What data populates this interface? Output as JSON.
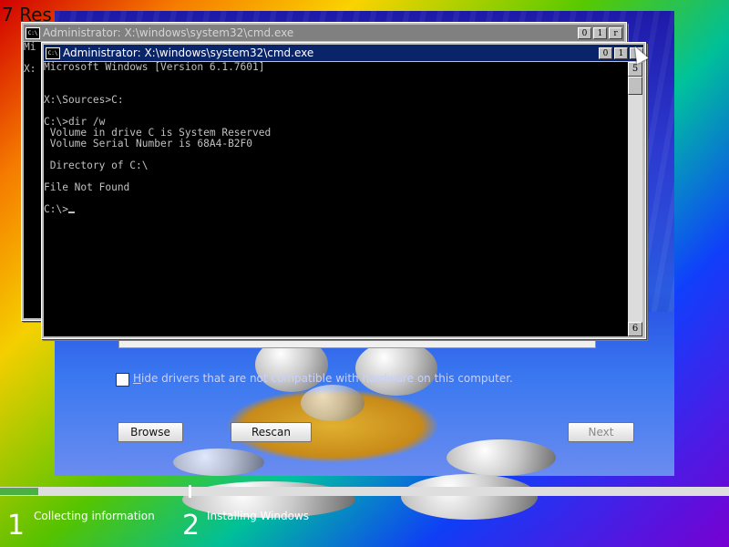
{
  "desktop": {
    "corner_text": "7 Res"
  },
  "setup": {
    "hide_drivers_label": "Hide drivers that are not compatible with hardware on this computer.",
    "hide_drivers_checked": false,
    "browse_label": "Browse",
    "rescan_label": "Rescan",
    "next_label": "Next"
  },
  "progress": {
    "fraction": 0.053,
    "steps": [
      {
        "number": "1",
        "label": "Collecting information"
      },
      {
        "number": "2",
        "label": "Installing Windows"
      }
    ]
  },
  "back_console": {
    "title": "Administrator: X:\\windows\\system32\\cmd.exe",
    "lines": [
      "Mi",
      "",
      "X:"
    ],
    "controls": [
      "0",
      "1",
      "r"
    ]
  },
  "front_console": {
    "title": "Administrator: X:\\windows\\system32\\cmd.exe",
    "controls": [
      "0",
      "1"
    ],
    "scroll_up_glyph": "5",
    "scroll_down_glyph": "6",
    "lines": [
      "Microsoft Windows [Version 6.1.7601]",
      "",
      "",
      "X:\\Sources>C:",
      "",
      "C:\\>dir /w",
      " Volume in drive C is System Reserved",
      " Volume Serial Number is 68A4-B2F0",
      "",
      " Directory of C:\\",
      "",
      "File Not Found",
      "",
      "C:\\>"
    ]
  },
  "colors": {
    "title_active": "#0a246a",
    "title_inactive": "#808080",
    "console_bg": "#000000",
    "console_text": "#c0c0c0",
    "progress_fill": "#4ab044"
  },
  "icons": {
    "console_app": "console-window-icon",
    "pointer": "mouse-pointer-icon"
  }
}
